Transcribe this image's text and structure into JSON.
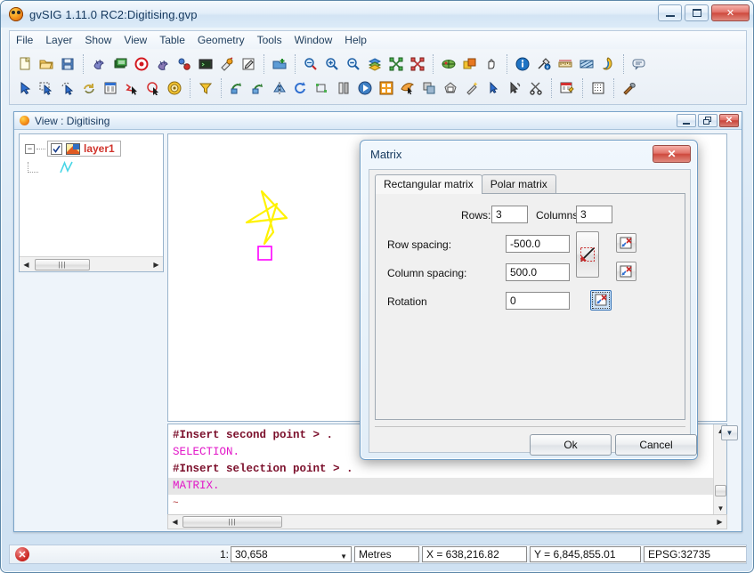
{
  "app": {
    "title": "gvSIG 1.11.0 RC2:Digitising.gvp",
    "icon": "gvsig-logo-icon",
    "window_controls": {
      "minimize": "minimize-button",
      "maximize": "maximize-button",
      "close": "✕"
    }
  },
  "menubar": {
    "items": [
      {
        "label": "File"
      },
      {
        "label": "Layer"
      },
      {
        "label": "Show"
      },
      {
        "label": "View"
      },
      {
        "label": "Table"
      },
      {
        "label": "Geometry"
      },
      {
        "label": "Tools"
      },
      {
        "label": "Window"
      },
      {
        "label": "Help"
      }
    ]
  },
  "toolbars": {
    "row1": [
      {
        "name": "new-project-icon",
        "sep_after": false
      },
      {
        "name": "open-project-icon",
        "sep_after": false
      },
      {
        "name": "save-project-icon",
        "sep_after": true
      },
      {
        "name": "add-layer-icon",
        "sep_after": false
      },
      {
        "name": "layer-properties-icon",
        "sep_after": false
      },
      {
        "name": "start-editing-icon",
        "sep_after": false
      },
      {
        "name": "layer-export-icon",
        "sep_after": false
      },
      {
        "name": "add-event-layer-icon",
        "sep_after": false
      },
      {
        "name": "console-icon",
        "sep_after": false
      },
      {
        "name": "snapping-icon",
        "sep_after": false
      },
      {
        "name": "edit-properties-icon",
        "sep_after": true
      },
      {
        "name": "add-view-layer-icon",
        "sep_after": true
      },
      {
        "name": "zoom-previous-icon",
        "sep_after": false
      },
      {
        "name": "zoom-in-icon",
        "sep_after": false
      },
      {
        "name": "zoom-out-icon",
        "sep_after": false
      },
      {
        "name": "zoom-full-extent-icon",
        "sep_after": false
      },
      {
        "name": "zoom-to-selection-icon",
        "sep_after": false
      },
      {
        "name": "zoom-layer-extent-icon",
        "sep_after": true
      },
      {
        "name": "locator-icon",
        "sep_after": false
      },
      {
        "name": "frame-tool-icon",
        "sep_after": false
      },
      {
        "name": "pan-icon",
        "sep_after": true
      },
      {
        "name": "info-icon",
        "sep_after": false
      },
      {
        "name": "hyperlink-icon",
        "sep_after": false
      },
      {
        "name": "measure-distance-icon",
        "sep_after": false
      },
      {
        "name": "measure-area-icon",
        "sep_after": false
      },
      {
        "name": "catalog-icon",
        "sep_after": true
      },
      {
        "name": "annotation-icon",
        "sep_after": false
      }
    ],
    "row2": [
      {
        "name": "select-pointer-icon",
        "sep_after": false
      },
      {
        "name": "select-rectangle-icon",
        "sep_after": false
      },
      {
        "name": "select-polygon-icon",
        "sep_after": false
      },
      {
        "name": "undo-redo-icon",
        "sep_after": false
      },
      {
        "name": "attribute-table-icon",
        "sep_after": false
      },
      {
        "name": "select-by-polyline-icon",
        "sep_after": false
      },
      {
        "name": "select-by-circle-icon",
        "sep_after": false
      },
      {
        "name": "select-by-buffer-icon",
        "sep_after": true
      },
      {
        "name": "filter-icon",
        "sep_after": true
      },
      {
        "name": "rotate-geometry-icon",
        "sep_after": false
      },
      {
        "name": "scale-geometry-icon",
        "sep_after": false
      },
      {
        "name": "symmetry-icon",
        "sep_after": false
      },
      {
        "name": "rotate-icon",
        "sep_after": false
      },
      {
        "name": "stretch-icon",
        "sep_after": false
      },
      {
        "name": "split-icon",
        "sep_after": false
      },
      {
        "name": "copy-geometry-icon",
        "sep_after": false
      },
      {
        "name": "matrix-icon",
        "sep_after": false
      },
      {
        "name": "join-icon",
        "sep_after": false
      },
      {
        "name": "duplicate-icon",
        "sep_after": false
      },
      {
        "name": "explode-icon",
        "sep_after": false
      },
      {
        "name": "magic-wand-icon",
        "sep_after": false
      },
      {
        "name": "edit-vertex-icon",
        "sep_after": false
      },
      {
        "name": "erase-icon",
        "sep_after": false
      },
      {
        "name": "cut-icon",
        "sep_after": true
      },
      {
        "name": "table-edit-icon",
        "sep_after": true
      },
      {
        "name": "grid-settings-icon",
        "sep_after": true
      },
      {
        "name": "tools-icon",
        "sep_after": false
      }
    ]
  },
  "view_window": {
    "title": "View : Digitising",
    "icon": "gvsig-view-icon",
    "controls": {
      "minimize": "minimize-button",
      "restore": "restore-button",
      "close": "✕"
    },
    "toc": {
      "expander": "−",
      "checkbox_checked": true,
      "layer_label": "layer1",
      "layer_icon": "vector-layer-icon",
      "symbol_icon": "polyline-symbol-icon"
    },
    "map": {
      "geometry_name": "star-polyline",
      "geometry_color": "#FFF200",
      "selection_marker_color": "#FF00FF"
    },
    "console": {
      "lines": [
        {
          "prompt": "#Insert second point > .",
          "type": "prompt",
          "highlight": false
        },
        {
          "cmd": "SELECTION.",
          "type": "cmd",
          "highlight": false
        },
        {
          "prompt": "#Insert selection point > .",
          "type": "prompt",
          "highlight": false
        },
        {
          "cmd": "MATRIX.",
          "type": "cmd",
          "highlight": true
        },
        {
          "prompt": "~",
          "type": "tilde",
          "highlight": false
        }
      ]
    }
  },
  "matrix_dialog": {
    "title": "Matrix",
    "close_glyph": "✕",
    "tabs": [
      {
        "label": "Rectangular matrix",
        "active": true
      },
      {
        "label": "Polar matrix",
        "active": false
      }
    ],
    "fields": {
      "rows_label": "Rows:",
      "rows_value": "3",
      "columns_label": "Columns:",
      "columns_value": "3",
      "row_spacing_label": "Row spacing:",
      "row_spacing_value": "-500.0",
      "column_spacing_label": "Column spacing:",
      "column_spacing_value": "500.0",
      "rotation_label": "Rotation",
      "rotation_value": "0"
    },
    "icon_buttons": {
      "diagonal_picker": "pick-diagonal-icon",
      "row_picker": "pick-row-spacing-icon",
      "column_picker": "pick-column-spacing-icon",
      "rotation_picker": "pick-rotation-icon"
    },
    "buttons": {
      "ok": "Ok",
      "cancel": "Cancel"
    }
  },
  "status_bar": {
    "error_icon": "error-status-icon",
    "scale_prefix": "1:",
    "scale_value": "30,658",
    "units": "Metres",
    "x_coordinate": "X = 638,216.82",
    "y_coordinate": "Y = 6,845,855.01",
    "projection": "EPSG:32735"
  }
}
